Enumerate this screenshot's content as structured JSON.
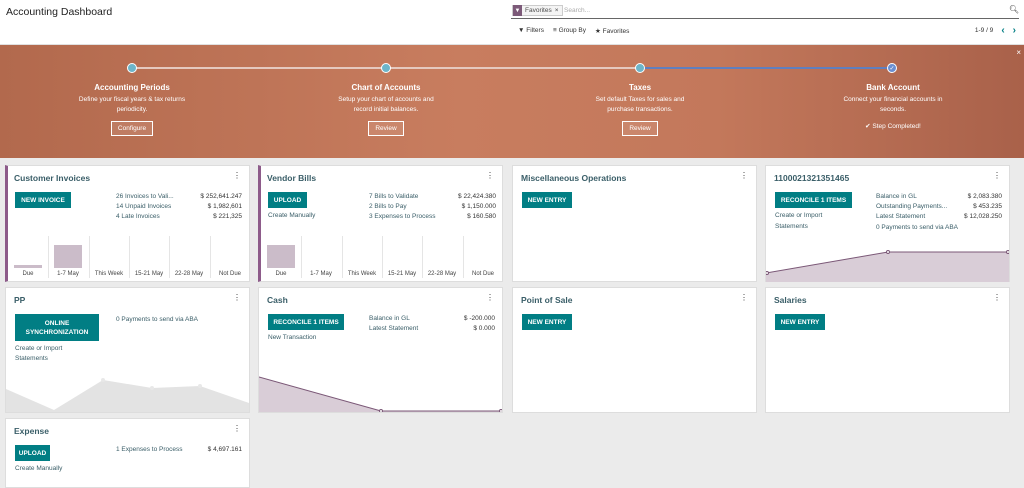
{
  "header": {
    "title": "Accounting Dashboard"
  },
  "search": {
    "facet_label": "Favorites",
    "facet_remove": "×",
    "placeholder": "Search...",
    "icon": "search-icon"
  },
  "toolbar": {
    "filters": "Filters",
    "group_by": "Group By",
    "favorites": "Favorites"
  },
  "pager": {
    "value": "1-9 / 9"
  },
  "onboarding": {
    "steps": [
      {
        "title": "Accounting Periods",
        "desc1": "Define your fiscal years & tax returns",
        "desc2": "periodicity.",
        "button": "Configure"
      },
      {
        "title": "Chart of Accounts",
        "desc1": "Setup your chart of accounts and",
        "desc2": "record initial balances.",
        "button": "Review"
      },
      {
        "title": "Taxes",
        "desc1": "Set default Taxes for sales and",
        "desc2": "purchase transactions.",
        "button": "Review"
      },
      {
        "title": "Bank Account",
        "desc1": "Connect your financial accounts in",
        "desc2": "seconds.",
        "status": "✔ Step Completed!"
      }
    ],
    "close": "×"
  },
  "journals": {
    "customer_invoices": {
      "title": "Customer Invoices",
      "button": "NEW INVOICE",
      "rows": [
        {
          "label": "26 Invoices to Vali...",
          "value": "$ 252,641.247"
        },
        {
          "label": "14 Unpaid Invoices",
          "value": "$ 1,982,601"
        },
        {
          "label": "4 Late Invoices",
          "value": "$ 221,325"
        }
      ],
      "chart_labels": [
        "Due",
        "1-7 May",
        "This Week",
        "15-21 May",
        "22-28 May",
        "Not Due"
      ],
      "bars": [
        0.1,
        0.9,
        0,
        0,
        0,
        0
      ]
    },
    "vendor_bills": {
      "title": "Vendor Bills",
      "button": "UPLOAD",
      "link": "Create Manually",
      "rows": [
        {
          "label": "7 Bills to Validate",
          "value": "$ 22,424.380"
        },
        {
          "label": "2 Bills to Pay",
          "value": "$ 1,150.000"
        },
        {
          "label": "3 Expenses to Process",
          "value": "$ 160.580"
        }
      ],
      "chart_labels": [
        "Due",
        "1-7 May",
        "This Week",
        "15-21 May",
        "22-28 May",
        "Not Due"
      ],
      "bars": [
        0.9,
        0,
        0,
        0,
        0,
        0
      ]
    },
    "misc": {
      "title": "Miscellaneous Operations",
      "button": "NEW ENTRY"
    },
    "bank": {
      "title": "1100021321351465",
      "button": "RECONCILE 1 ITEMS",
      "link1": "Create or Import",
      "link2": "Statements",
      "rows": [
        {
          "label": "Balance in GL",
          "value": "$ 2,083.380"
        },
        {
          "label": "Outstanding Payments...",
          "value": "$ 453.235"
        },
        {
          "label": "Latest Statement",
          "value": "$ 12,028.250"
        }
      ],
      "extra": "0 Payments to send via ABA"
    },
    "pp": {
      "title": "PP",
      "button1": "ONLINE",
      "button2": "SYNCHRONIZATION",
      "link1": "Create or Import",
      "link2": "Statements",
      "extra": "0 Payments to send via ABA"
    },
    "cash": {
      "title": "Cash",
      "button": "RECONCILE 1 ITEMS",
      "link": "New Transaction",
      "rows": [
        {
          "label": "Balance in GL",
          "value": "$ -200.000"
        },
        {
          "label": "Latest Statement",
          "value": "$ 0.000"
        }
      ]
    },
    "pos": {
      "title": "Point of Sale",
      "button": "NEW ENTRY"
    },
    "salaries": {
      "title": "Salaries",
      "button": "NEW ENTRY"
    },
    "expense": {
      "title": "Expense",
      "button": "UPLOAD",
      "link": "Create Manually",
      "rows": [
        {
          "label": "1 Expenses to Process",
          "value": "$ 4,697.161"
        }
      ]
    }
  },
  "colors": {
    "accent": "#017e84",
    "brand": "#8d5b8a",
    "banner": "#c87d5f"
  }
}
